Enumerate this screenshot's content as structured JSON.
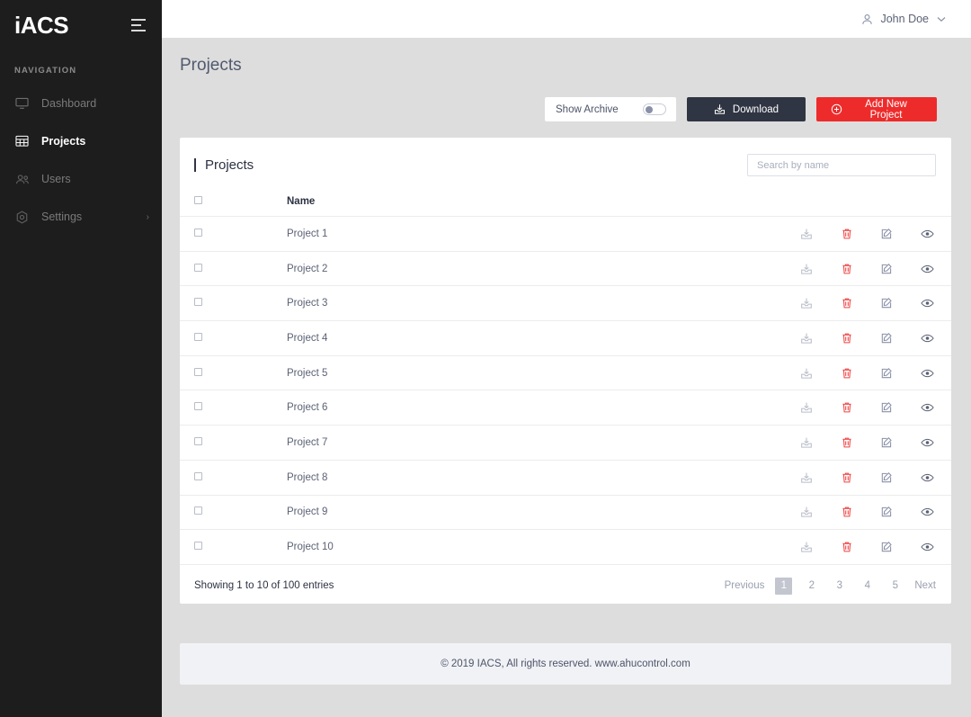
{
  "sidebar": {
    "brand": "iACS",
    "menu_icon": "hamburger-icon",
    "nav_title": "NAVIGATION",
    "items": [
      {
        "label": "Dashboard",
        "icon": "monitor-icon",
        "active": false
      },
      {
        "label": "Projects",
        "icon": "grid-building-icon",
        "active": true
      },
      {
        "label": "Users",
        "icon": "users-icon",
        "active": false
      },
      {
        "label": "Settings",
        "icon": "gear-icon",
        "active": false,
        "chevron": "›"
      }
    ]
  },
  "topbar": {
    "user_name": "John Doe",
    "user_icon": "user-icon",
    "chevron_icon": "chevron-down-icon"
  },
  "page": {
    "title": "Projects"
  },
  "toolbar": {
    "archive_label": "Show Archive",
    "archive_toggle_on": false,
    "download_label": "Download",
    "download_icon": "download-icon",
    "add_label": "Add New Project",
    "add_icon": "plus-circle-icon",
    "download_color": "#2f3542",
    "add_color": "#ee2b2b"
  },
  "card": {
    "title": "Projects",
    "search_placeholder": "Search by name",
    "search_value": ""
  },
  "table": {
    "columns": [
      "",
      "Name",
      ""
    ],
    "name_header": "Name",
    "row_actions": [
      {
        "icon": "download-tray-icon",
        "color": "#b9bdc9"
      },
      {
        "icon": "trash-icon",
        "color": "#ee4444"
      },
      {
        "icon": "edit-pencil-icon",
        "color": "#8a90a8"
      },
      {
        "icon": "eye-icon",
        "color": "#5b6275"
      }
    ],
    "rows": [
      {
        "name": "Project 1",
        "checked": false
      },
      {
        "name": "Project 2",
        "checked": false
      },
      {
        "name": "Project 3",
        "checked": false
      },
      {
        "name": "Project 4",
        "checked": false
      },
      {
        "name": "Project 5",
        "checked": false
      },
      {
        "name": "Project 6",
        "checked": false
      },
      {
        "name": "Project 7",
        "checked": false
      },
      {
        "name": "Project 8",
        "checked": false
      },
      {
        "name": "Project 9",
        "checked": false
      },
      {
        "name": "Project 10",
        "checked": false
      }
    ]
  },
  "pagination": {
    "entries_text": "Showing 1 to 10 of 100 entries",
    "previous_label": "Previous",
    "next_label": "Next",
    "pages": [
      "1",
      "2",
      "3",
      "4",
      "5"
    ],
    "active_page": "1"
  },
  "footer": {
    "text": "© 2019 IACS,  All rights reserved. www.ahucontrol.com"
  }
}
